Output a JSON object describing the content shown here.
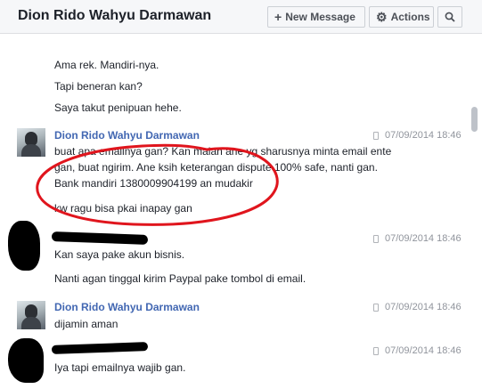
{
  "header": {
    "title": "Dion Rido Wahyu Darmawan",
    "new_message_label": "New Message",
    "actions_label": "Actions"
  },
  "messages": {
    "prev_1": "Ama rek. Mandiri-nya.",
    "prev_2": "Tapi beneran kan?",
    "prev_3": "Saya takut penipuan hehe.",
    "g1_name": "Dion Rido Wahyu Darmawan",
    "g1_time": "07/09/2014 18:46",
    "g1_line1": "buat apa emailnya gan? Kan malah ane yg sharusnya minta email ente",
    "g1_line2": "gan, buat ngirim. Ane ksih keterangan   dispute 100% safe, nanti gan.",
    "g1_line3": "Bank mandiri 1380009904199 an mudakir",
    "g1_line4": "kw ragu bisa pkai inapay gan",
    "g2_time": "07/09/2014 18:46",
    "g2_line1": "Kan saya pake akun bisnis.",
    "g2_line2": "Nanti agan tinggal kirim Paypal pake tombol di email.",
    "g3_name": "Dion Rido Wahyu Darmawan",
    "g3_time": "07/09/2014 18:46",
    "g3_line1": "dijamin aman",
    "g4_time": "07/09/2014 18:46",
    "g4_line1": "Iya tapi emailnya wajib gan."
  },
  "colors": {
    "link_blue": "#4267b2",
    "annotation_red": "#e0151d",
    "header_bg": "#f6f7f9"
  }
}
